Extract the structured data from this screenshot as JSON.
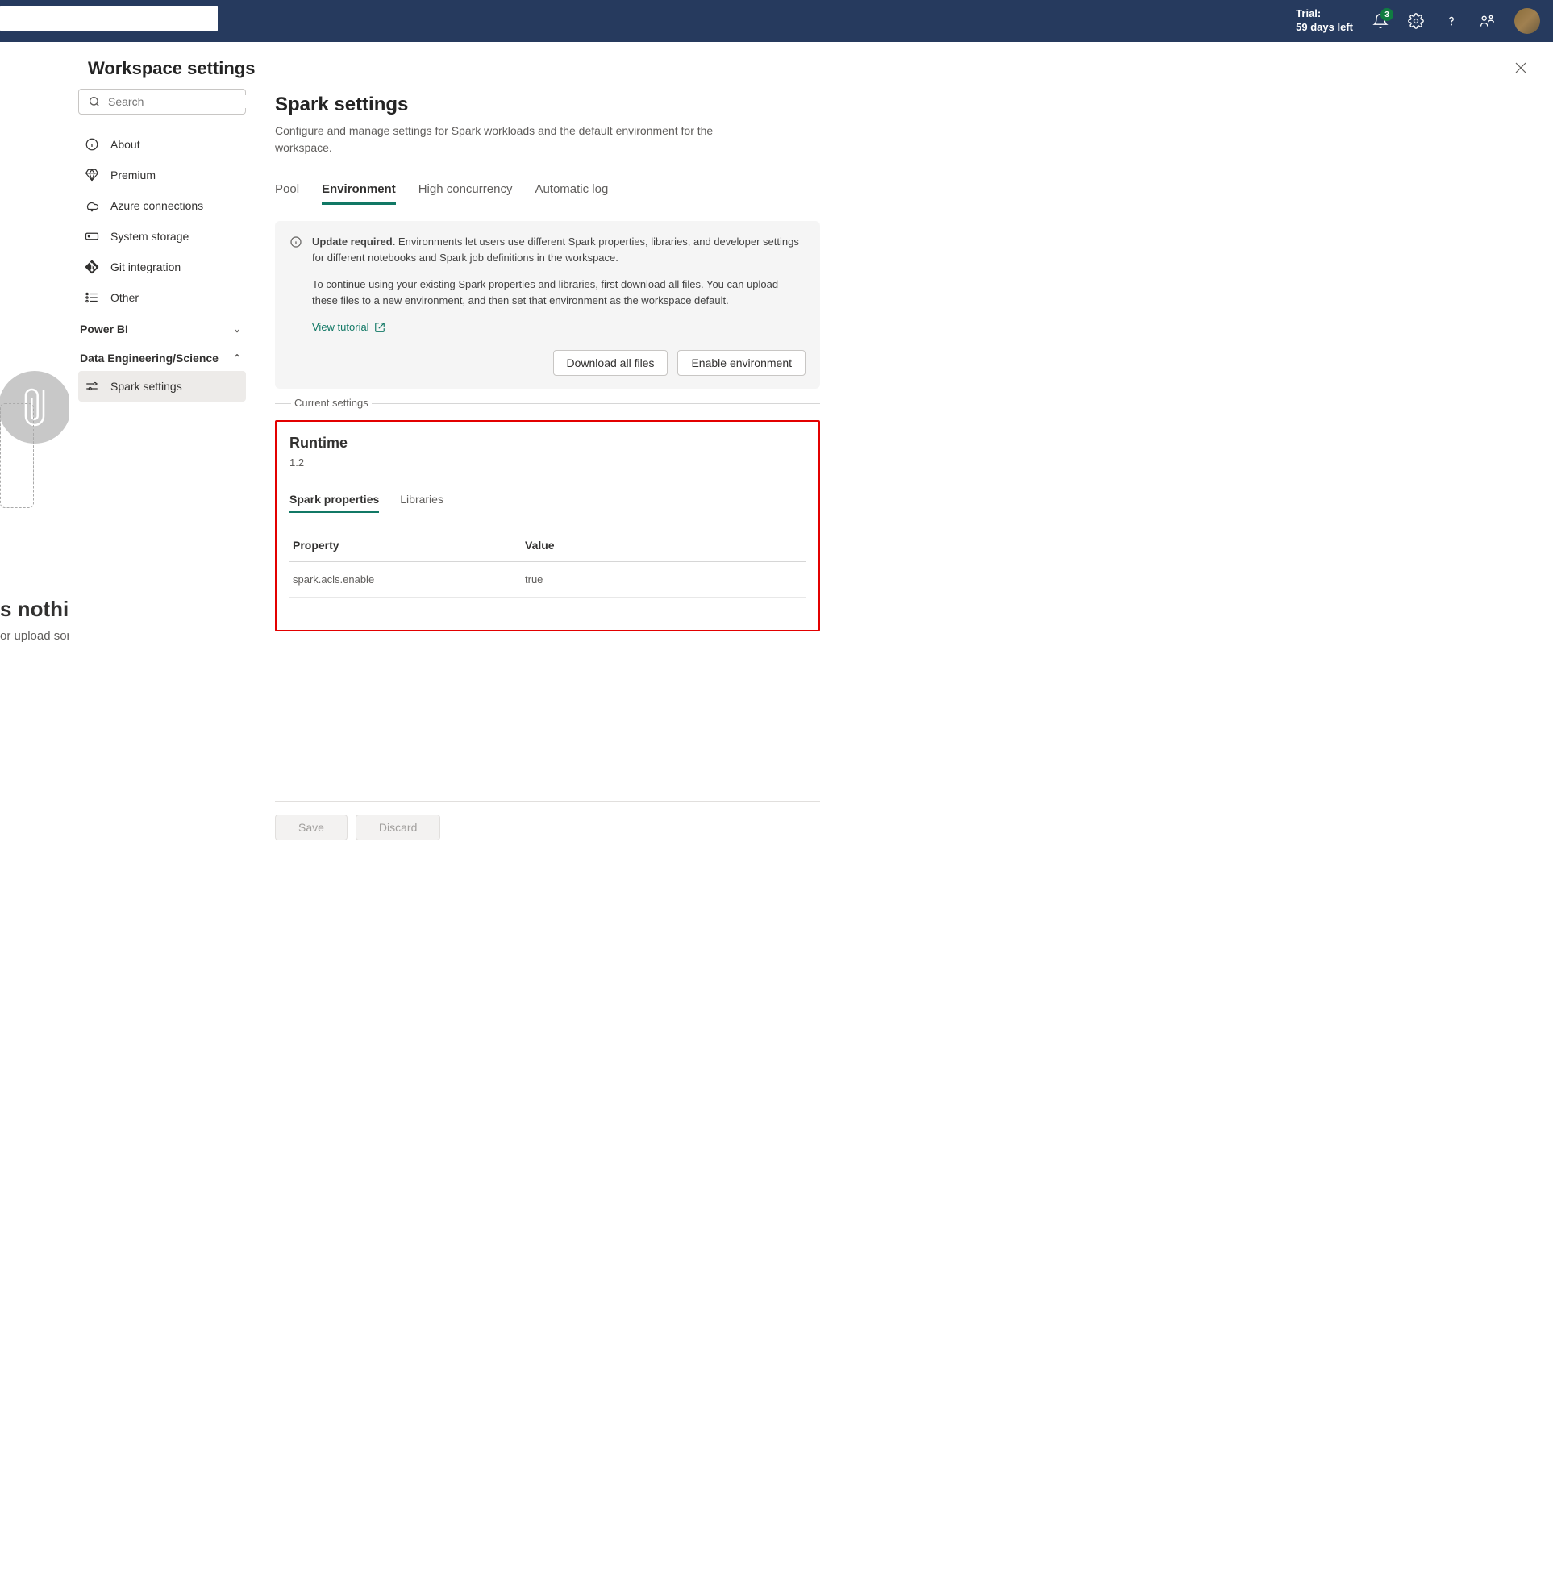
{
  "header": {
    "trial_line1": "Trial:",
    "trial_line2": "59 days left",
    "notification_count": "3"
  },
  "background": {
    "heading": "s nothing",
    "sub": "or upload som"
  },
  "modal_title": "Workspace settings",
  "search_placeholder": "Search",
  "sidebar": {
    "items": {
      "about": "About",
      "premium": "Premium",
      "azure": "Azure connections",
      "storage": "System storage",
      "git": "Git integration",
      "other": "Other"
    },
    "groups": {
      "powerbi": "Power BI",
      "de": "Data Engineering/Science"
    },
    "spark_settings": "Spark settings"
  },
  "main": {
    "title": "Spark settings",
    "description": "Configure and manage settings for Spark workloads and the default environment for the workspace.",
    "tabs": {
      "pool": "Pool",
      "environment": "Environment",
      "high_concurrency": "High concurrency",
      "automatic_log": "Automatic log"
    },
    "info": {
      "title": "Update required.",
      "text1": "Environments let users use different Spark properties, libraries, and developer settings for different notebooks and Spark job definitions in the workspace.",
      "text2": "To continue using your existing Spark properties and libraries, first download all files. You can upload these files to a new environment, and then set that environment as the workspace default.",
      "tutorial": "View tutorial",
      "download": "Download all files",
      "enable": "Enable environment"
    },
    "fieldset_label": "Current settings",
    "runtime": {
      "title": "Runtime",
      "version": "1.2",
      "subtabs": {
        "spark_properties": "Spark properties",
        "libraries": "Libraries"
      },
      "table": {
        "col_property": "Property",
        "col_value": "Value",
        "rows": [
          {
            "property": "spark.acls.enable",
            "value": "true"
          }
        ]
      }
    },
    "footer": {
      "save": "Save",
      "discard": "Discard"
    }
  }
}
